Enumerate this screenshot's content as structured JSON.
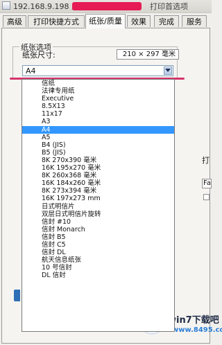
{
  "window": {
    "title_prefix": "192.168.9.198 上的",
    "title_suffix": "打印首选项"
  },
  "tabs": [
    {
      "label": "高级"
    },
    {
      "label": "打印快捷方式"
    },
    {
      "label": "纸张/质量"
    },
    {
      "label": "效果"
    },
    {
      "label": "完成"
    },
    {
      "label": "服务"
    }
  ],
  "paper_options": {
    "group_title": "纸张选项",
    "size_label": "纸张尺寸:",
    "size_dimensions": "210 × 297 毫米",
    "selected": "A4",
    "list": [
      "信纸",
      "法律专用纸",
      "Executive",
      "8.5X13",
      "11x17",
      "A3",
      "A4",
      "A5",
      "B4 (JIS)",
      "B5 (JIS)",
      "8K 270x390 毫米",
      "16K 195x270 毫米",
      "8K 260x368 毫米",
      "16K 184x260 毫米",
      "8K 273x394 毫米",
      "16K 197x273 mm",
      "日式明信片",
      "双层日式明信片旋转",
      "信封 #10",
      "信封 Monarch",
      "信封 B5",
      "信封 C5",
      "信封 DL",
      "航天信息纸张",
      "10 号信封",
      "DL 信封"
    ]
  },
  "right_panel": {
    "label": "打",
    "field_value": "Fa"
  },
  "watermark": {
    "brand": "win7下载吧",
    "url": "www.8495.com"
  }
}
